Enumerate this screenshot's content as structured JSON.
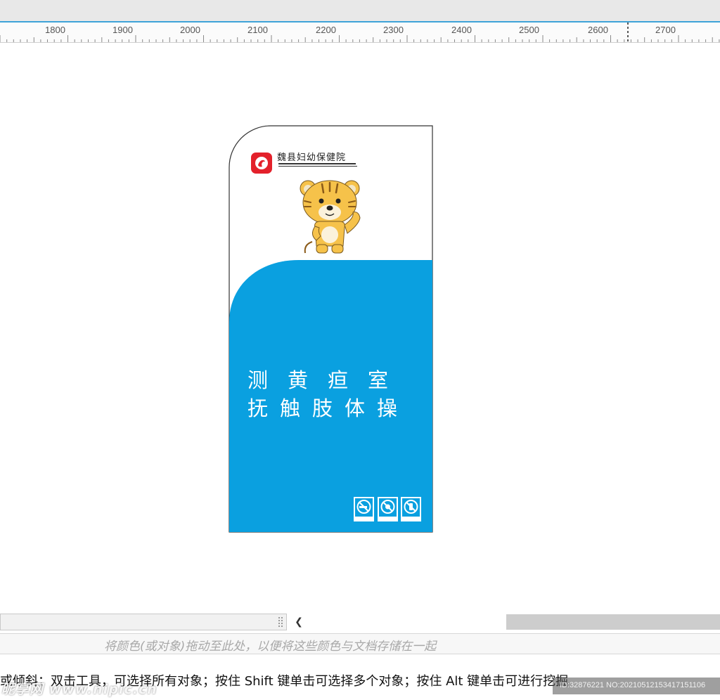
{
  "ruler": {
    "labels": [
      "1800",
      "1900",
      "2000",
      "2100",
      "2200",
      "2300",
      "2400",
      "2500",
      "2600",
      "2700"
    ]
  },
  "card": {
    "hospital_name": "魏县妇幼保健院",
    "title_line1": "测黄疸室",
    "title_line2": "抚触肢体操",
    "colors": {
      "blue": "#0aa0e0",
      "logo_red": "#e3212b"
    },
    "signs": [
      "no-smoking-icon",
      "no-food-icon",
      "no-phone-icon"
    ]
  },
  "palette_hint": "将颜色(或对象)拖动至此处，以便将这些颜色与文档存储在一起",
  "status": {
    "text": "或倾斜；双击工具，可选择所有对象；按住 Shift 键单击可选择多个对象；按住 Alt 键单击可进行挖掘"
  },
  "watermark": {
    "left": "昵享网 www.nipic.cn",
    "right": "ID:32876221 NO:20210512153417151106"
  }
}
